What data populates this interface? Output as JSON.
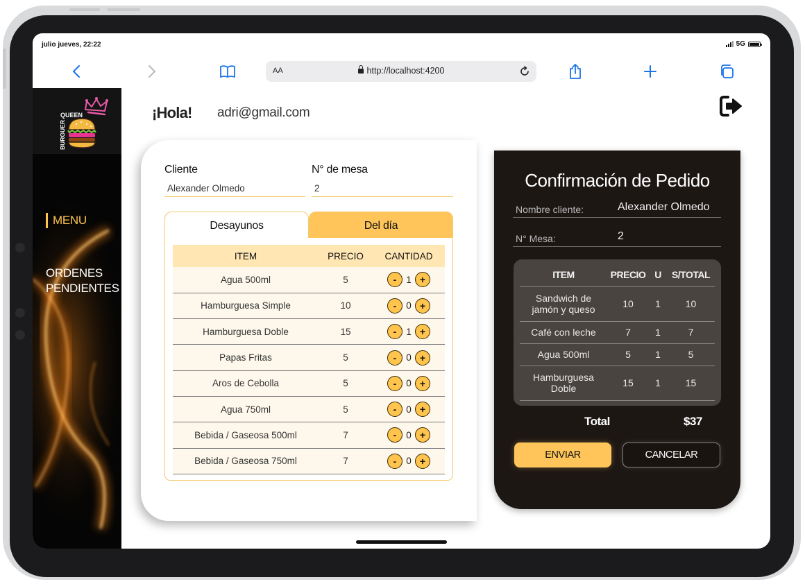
{
  "status_bar": {
    "time": "julio jueves, 22:22",
    "network": "5G"
  },
  "browser": {
    "aa_label": "AA",
    "url": "http://localhost:4200"
  },
  "sidebar": {
    "logo_text_top": "QUEEN",
    "logo_text_side": "BURGUER",
    "menu_label": "MENU",
    "pending_label": "ORDENES PENDIENTES"
  },
  "header": {
    "greeting": "¡Hola!",
    "email": "adri@gmail.com"
  },
  "order_form": {
    "client_label": "Cliente",
    "client_value": "Alexander Olmedo",
    "table_label": "N° de mesa",
    "table_value": "2",
    "tabs": [
      "Desayunos",
      "Del día"
    ],
    "active_tab": "Del día",
    "columns": [
      "ITEM",
      "PRECIO",
      "CANTIDAD"
    ],
    "minus_label": "-",
    "plus_label": "+",
    "items": [
      {
        "name": "Agua 500ml",
        "price": "5",
        "qty": "1"
      },
      {
        "name": "Hamburguesa Simple",
        "price": "10",
        "qty": "0"
      },
      {
        "name": "Hamburguesa Doble",
        "price": "15",
        "qty": "1"
      },
      {
        "name": "Papas Fritas",
        "price": "5",
        "qty": "0"
      },
      {
        "name": "Aros de Cebolla",
        "price": "5",
        "qty": "0"
      },
      {
        "name": "Agua 750ml",
        "price": "5",
        "qty": "0"
      },
      {
        "name": "Bebida / Gaseosa 500ml",
        "price": "7",
        "qty": "0"
      },
      {
        "name": "Bebida / Gaseosa 750ml",
        "price": "7",
        "qty": "0"
      }
    ]
  },
  "confirmation": {
    "title": "Confirmación de Pedido",
    "client_label": "Nombre cliente:",
    "client_value": "Alexander Olmedo",
    "table_label": "N° Mesa:",
    "table_value": "2",
    "columns": [
      "ITEM",
      "PRECIO",
      "U",
      "S/TOTAL"
    ],
    "items": [
      {
        "name": "Sandwich de jamón y queso",
        "price": "10",
        "units": "1",
        "subtotal": "10"
      },
      {
        "name": "Café con leche",
        "price": "7",
        "units": "1",
        "subtotal": "7"
      },
      {
        "name": "Agua 500ml",
        "price": "5",
        "units": "1",
        "subtotal": "5"
      },
      {
        "name": "Hamburguesa Doble",
        "price": "15",
        "units": "1",
        "subtotal": "15"
      }
    ],
    "total_label": "Total",
    "total_value": "$37",
    "send_label": "ENVIAR",
    "cancel_label": "CANCELAR"
  },
  "colors": {
    "accent": "#ffc55a",
    "panel_dark": "#1d1714",
    "summary_bg": "#4a4440",
    "table_header": "#ffe6b3",
    "row_bg": "#fef8ec"
  },
  "icons": [
    "back-chevron-icon",
    "forward-chevron-icon",
    "bookmarks-icon",
    "lock-icon",
    "reload-icon",
    "share-icon",
    "new-tab-icon",
    "tabs-icon",
    "logout-icon",
    "crown-icon",
    "burger-icon"
  ]
}
